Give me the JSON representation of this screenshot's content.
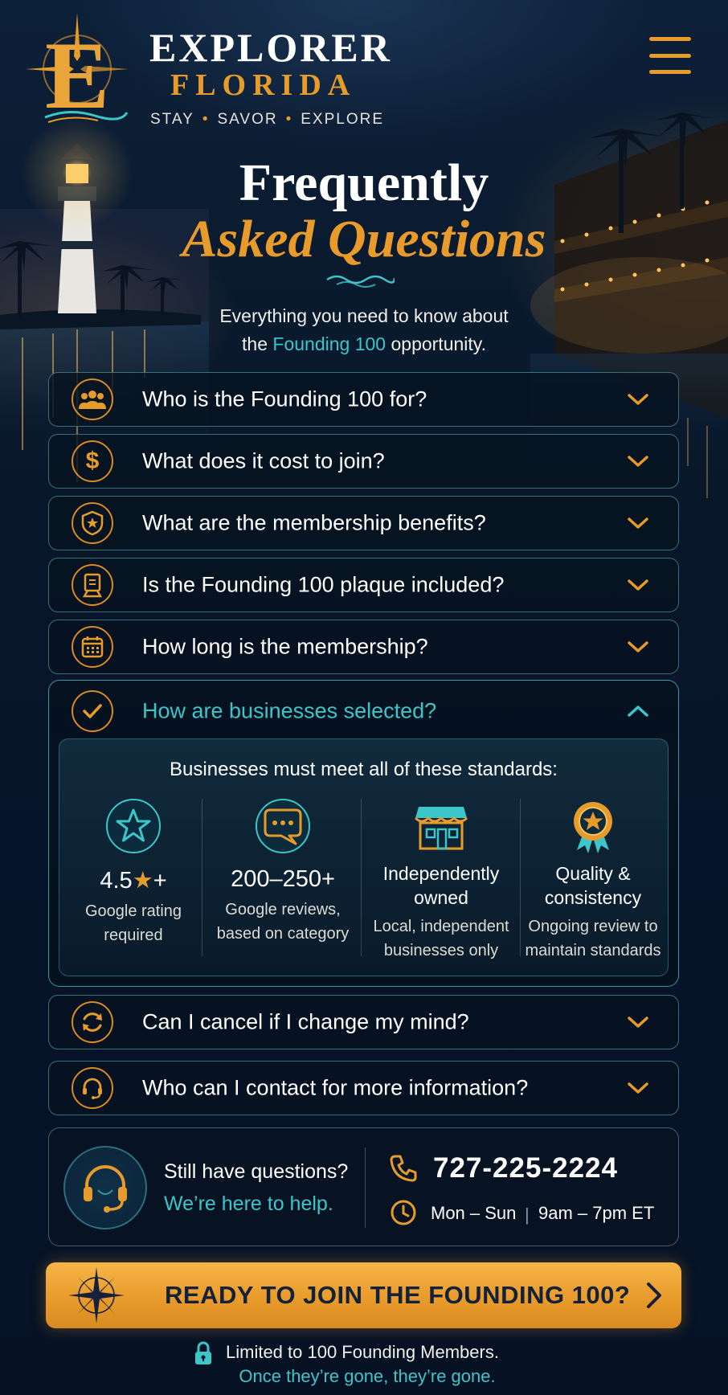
{
  "brand": {
    "line1": "EXPLORER",
    "line2": "FLORIDA",
    "tagline": [
      "STAY",
      "SAVOR",
      "EXPLORE"
    ],
    "colors": {
      "gold": "#e79b2a",
      "teal": "#3cc6c9",
      "navy": "#071424"
    }
  },
  "header": {
    "menu_icon": "hamburger-menu-icon"
  },
  "hero": {
    "title_line1": "Frequently",
    "title_line2": "Asked Questions",
    "intro_line1": "Everything you need to know about",
    "intro_prefix": "the",
    "intro_highlight": "Founding 100",
    "intro_suffix": "opportunity."
  },
  "faq": {
    "items": [
      {
        "question": "Who is the Founding 100 for?",
        "icon": "people-group-icon",
        "expanded": false
      },
      {
        "question": "What does it cost to join?",
        "icon": "dollar-icon",
        "expanded": false
      },
      {
        "question": "What are the membership benefits?",
        "icon": "shield-star-icon",
        "expanded": false
      },
      {
        "question": "Is the Founding 100 plaque included?",
        "icon": "plaque-icon",
        "expanded": false
      },
      {
        "question": "How long is the membership?",
        "icon": "calendar-icon",
        "expanded": false
      },
      {
        "question": "How are businesses selected?",
        "icon": "checkmark-circle-icon",
        "expanded": true
      },
      {
        "question": "Can I cancel if I change my mind?",
        "icon": "refresh-icon",
        "expanded": false
      },
      {
        "question": "Who can I contact for more information?",
        "icon": "headset-icon",
        "expanded": false
      }
    ],
    "standards": {
      "heading": "Businesses must meet all of these standards:",
      "columns": [
        {
          "icon": "star-icon",
          "value": "4.5",
          "value_star": "★",
          "value_suffix": "+",
          "desc_line1": "Google rating",
          "desc_line2": "required"
        },
        {
          "icon": "chat-bubble-icon",
          "value": "200–250+",
          "desc_line1": "Google reviews,",
          "desc_line2": "based on category"
        },
        {
          "icon": "storefront-icon",
          "name_line1": "Independently",
          "name_line2": "owned",
          "desc_line1": "Local, independent",
          "desc_line2": "businesses only"
        },
        {
          "icon": "award-ribbon-icon",
          "name_line1": "Quality &",
          "name_line2": "consistency",
          "desc_line1": "Ongoing review to",
          "desc_line2": "maintain standards"
        }
      ]
    }
  },
  "contact": {
    "still": "Still have questions?",
    "help": "We’re here to help.",
    "phone": "727-225-2224",
    "days": "Mon – Sun",
    "separator": "|",
    "hours": "9am – 7pm ET"
  },
  "cta": {
    "label": "READY TO JOIN THE FOUNDING 100?"
  },
  "footer": {
    "limit_line1": "Limited to 100 Founding Members.",
    "limit_line2": "Once they’re gone, they’re gone."
  }
}
